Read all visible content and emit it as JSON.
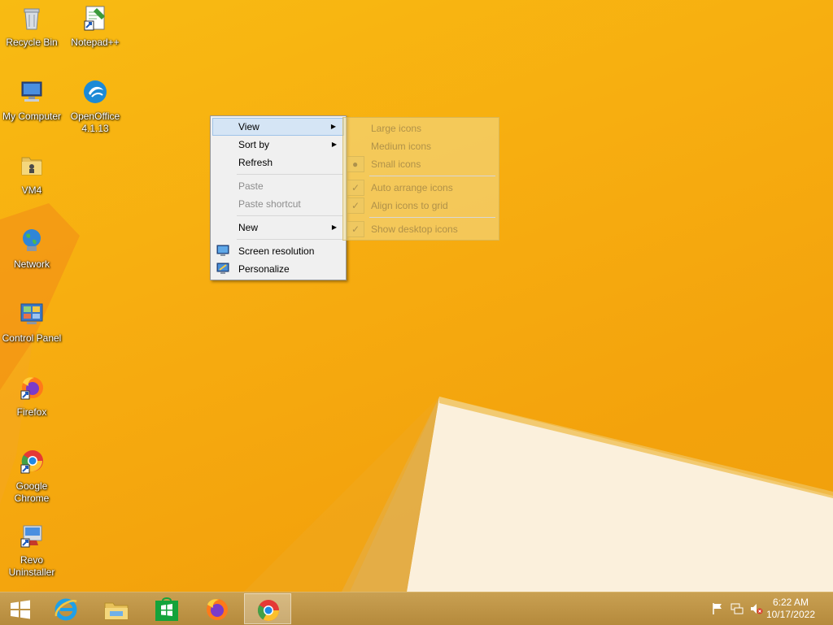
{
  "desktop_icons": [
    {
      "name": "recycle-bin-icon",
      "label": "Recycle Bin"
    },
    {
      "name": "notepad-plus-plus-icon",
      "label": "Notepad++"
    },
    {
      "name": "my-computer-icon",
      "label": "My Computer"
    },
    {
      "name": "openoffice-icon",
      "label": "OpenOffice\n4.1.13"
    },
    {
      "name": "vm4-folder-icon",
      "label": "VM4"
    },
    {
      "name": "network-icon",
      "label": "Network"
    },
    {
      "name": "control-panel-icon",
      "label": "Control Panel"
    },
    {
      "name": "firefox-icon",
      "label": "Firefox"
    },
    {
      "name": "google-chrome-icon",
      "label": "Google\nChrome"
    },
    {
      "name": "revo-uninstaller-icon",
      "label": "Revo\nUninstaller"
    }
  ],
  "context_menu": {
    "view": "View",
    "sort_by": "Sort by",
    "refresh": "Refresh",
    "paste": "Paste",
    "paste_shortcut": "Paste shortcut",
    "new": "New",
    "screen_resolution": "Screen resolution",
    "personalize": "Personalize"
  },
  "view_submenu": {
    "large_icons": "Large icons",
    "medium_icons": "Medium icons",
    "small_icons": "Small icons",
    "auto_arrange": "Auto arrange icons",
    "align_grid": "Align icons to grid",
    "show_desktop": "Show desktop icons",
    "selected_size": "Small icons",
    "checked": [
      "Auto arrange icons",
      "Align icons to grid",
      "Show desktop icons"
    ]
  },
  "taskbar": {
    "pinned": [
      "start-button",
      "internet-explorer",
      "file-explorer",
      "windows-store",
      "firefox",
      "google-chrome"
    ],
    "active": "google-chrome"
  },
  "clock": {
    "time": "6:22 AM",
    "date": "10/17/2022"
  },
  "colors": {
    "accent": "#f8bb12",
    "taskbar": "#c29649",
    "menu": "#f0f0f0",
    "highlight": "#d5e5f5"
  }
}
